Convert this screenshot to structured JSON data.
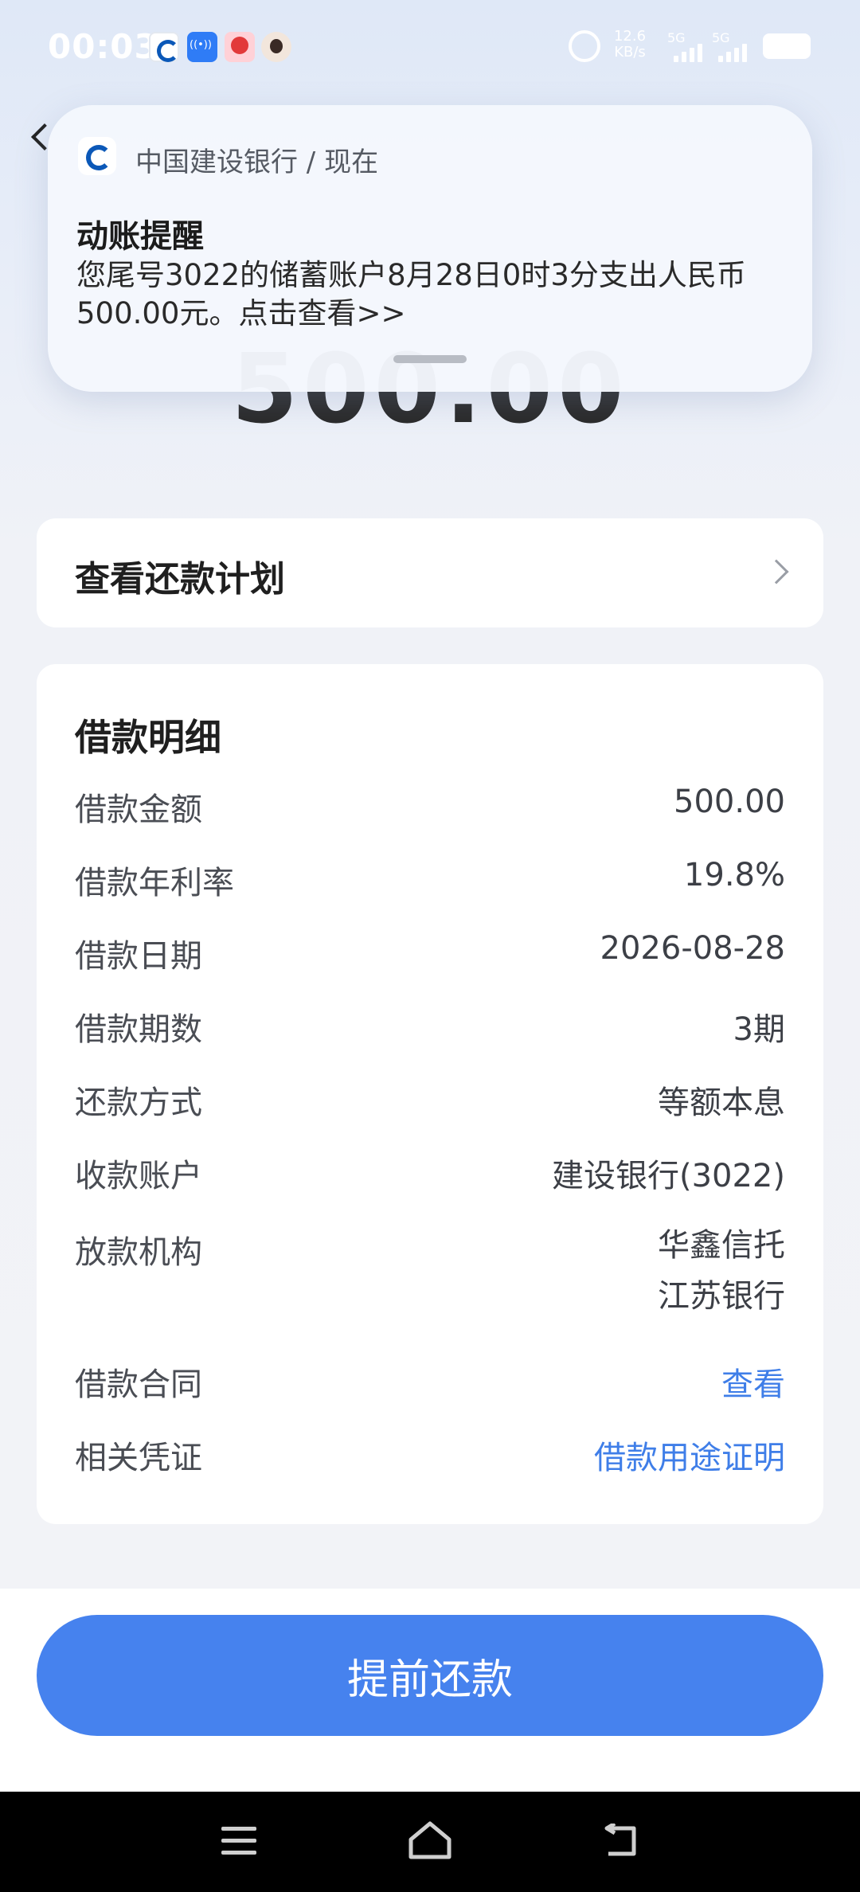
{
  "status_bar": {
    "time": "00:03",
    "net_speed_value": "12.6",
    "net_speed_unit": "KB/s",
    "signal1_label": "5G",
    "signal2_label": "5G"
  },
  "page": {
    "amount_display": "500.00"
  },
  "notification": {
    "app_name": "中国建设银行 / 现在",
    "title": "动账提醒",
    "body": "您尾号3022的储蓄账户8月28日0时3分支出人民币500.00元。点击查看>>"
  },
  "plan": {
    "label": "查看还款计划"
  },
  "details": {
    "title": "借款明细",
    "rows": [
      {
        "label": "借款金额",
        "value": "500.00"
      },
      {
        "label": "借款年利率",
        "value": "19.8%"
      },
      {
        "label": "借款日期",
        "value": "2026-08-28"
      },
      {
        "label": "借款期数",
        "value": "3期"
      },
      {
        "label": "还款方式",
        "value": "等额本息"
      },
      {
        "label": "收款账户",
        "value": "建设银行(3022)"
      }
    ],
    "institution": {
      "label": "放款机构",
      "values": [
        "华鑫信托",
        "江苏银行"
      ]
    },
    "contract": {
      "label": "借款合同",
      "value": "查看"
    },
    "voucher": {
      "label": "相关凭证",
      "value": "借款用途证明"
    }
  },
  "actions": {
    "prepay_label": "提前还款"
  },
  "colors": {
    "primary": "#4682ee",
    "link": "#3f7ee8",
    "bank_brand": "#0b58b8"
  }
}
